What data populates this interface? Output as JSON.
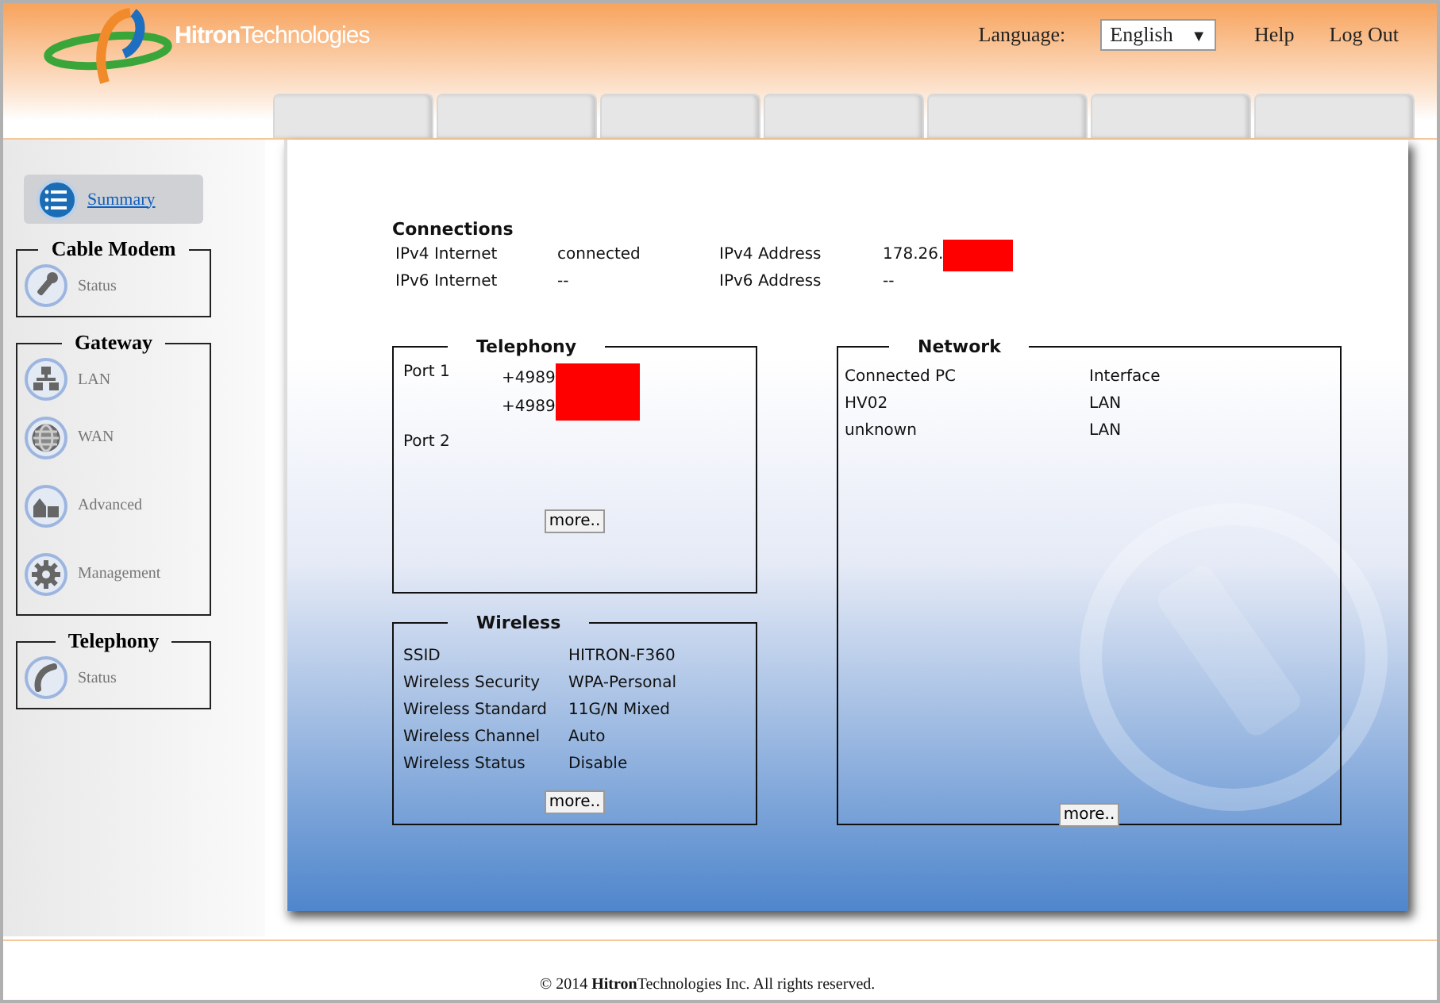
{
  "header": {
    "logo": "**Hitron**Technologies",
    "language_label": "Language:",
    "language_value": "English",
    "language_caret": "▼",
    "links": [
      "Help",
      "Log Out"
    ]
  },
  "sidebar": {
    "summary": {
      "label": "Summary",
      "selected": true
    },
    "groups": [
      {
        "title": "Cable Modem",
        "items": [
          {
            "label": "Status",
            "kind": "wrench",
            "selected": false
          }
        ]
      },
      {
        "title": "Gateway",
        "items": [
          {
            "label": "LAN",
            "kind": "network",
            "selected": false
          },
          {
            "label": "WAN",
            "kind": "globe",
            "selected": false
          },
          {
            "label": "Advanced",
            "kind": "house",
            "selected": false
          },
          {
            "label": "Management",
            "kind": "gear",
            "selected": false
          }
        ]
      },
      {
        "title": "Telephony",
        "items": [
          {
            "label": "Status",
            "kind": "phone",
            "selected": false
          }
        ]
      }
    ]
  },
  "connections": {
    "title": "Connections",
    "rows": [
      {
        "label": "IPv4 Internet",
        "value": "connected",
        "label2": "IPv4 Address",
        "value2": "178.26.",
        "redacted": true
      },
      {
        "label": "IPv6 Internet",
        "value": "--",
        "label2": "IPv6 Address",
        "value2": "--",
        "redacted": false
      }
    ]
  },
  "telephony": {
    "title": "Telephony",
    "ports": [
      {
        "label": "Port 1",
        "numbers": [
          {
            "text": "+4989",
            "redacted": true
          },
          {
            "text": "+4989",
            "redacted": true
          }
        ]
      },
      {
        "label": "Port 2"
      }
    ],
    "button": "more.."
  },
  "wireless": {
    "title": "Wireless",
    "rows": [
      {
        "label": "SSID",
        "value": "HITRON-F360"
      },
      {
        "label": "Wireless Security",
        "value": "WPA-Personal"
      },
      {
        "label": "Wireless Standard",
        "value": "11G/N Mixed"
      },
      {
        "label": "Wireless Channel",
        "value": "Auto"
      },
      {
        "label": "Wireless Status",
        "value": "Disable"
      }
    ],
    "button": "more.."
  },
  "network": {
    "title": "Network",
    "columns": [
      "Connected PC",
      "Interface"
    ],
    "rows": [
      [
        "HV02",
        "LAN"
      ],
      [
        "unknown",
        "LAN"
      ]
    ],
    "button": "more.."
  },
  "footer": "© 2014 **Hitron**Technologies Inc.  All rights reserved."
}
